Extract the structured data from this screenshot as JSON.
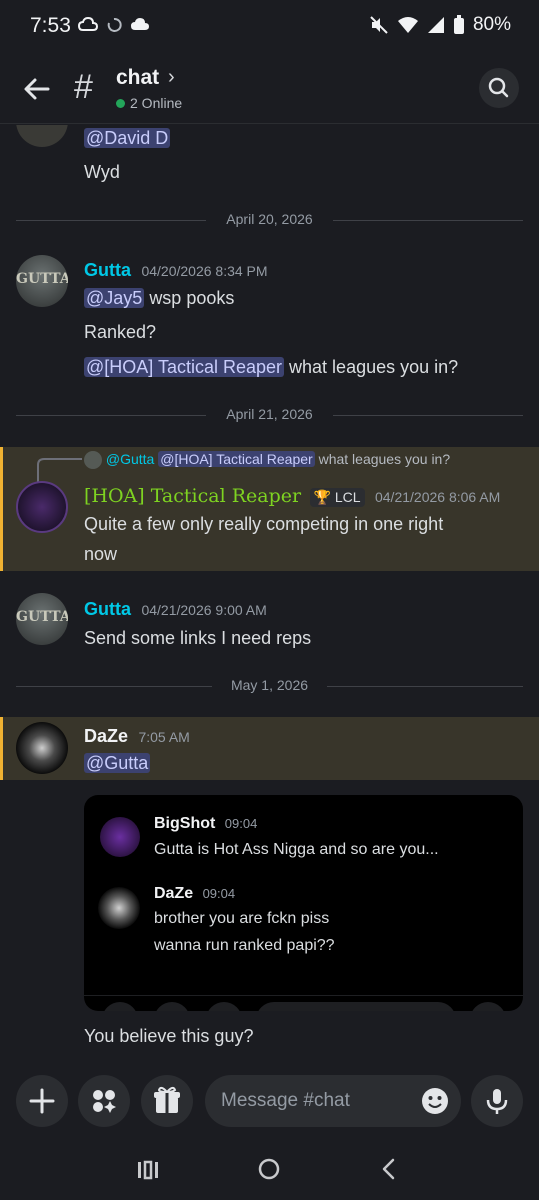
{
  "status": {
    "time": "7:53",
    "battery": "80%"
  },
  "header": {
    "channel": "chat",
    "online": "2 Online"
  },
  "messages": {
    "m0_mention": "@David D",
    "m0_text": "Wyd",
    "divider1": "April 20, 2026",
    "m1": {
      "name": "Gutta",
      "ts": "04/20/2026 8:34 PM",
      "avatar_text": "GUTTA",
      "l1_mention": "@Jay5",
      "l1_text": "wsp pooks",
      "l2": "Ranked?",
      "l3_mention": "@[HOA] Tactical Reaper",
      "l3_text": "what leagues you in?"
    },
    "divider2": "April 21, 2026",
    "m2": {
      "reply_name": "@Gutta",
      "reply_mention": "@[HOA] Tactical Reaper",
      "reply_text": "what leagues you in?",
      "name": "[HOA] Tactical Reaper",
      "badge": "LCL",
      "ts": "04/21/2026 8:06 AM",
      "text1": "Quite a few only really competing in one right",
      "text2": "now"
    },
    "m3": {
      "name": "Gutta",
      "ts": "04/21/2026 9:00 AM",
      "avatar_text": "GUTTA",
      "text": "Send some links I need reps"
    },
    "divider3": "May 1, 2026",
    "m4": {
      "name": "DaZe",
      "ts": "7:05 AM",
      "mention": "@Gutta"
    },
    "embed": {
      "e1": {
        "name": "BigShot",
        "ts": "09:04",
        "text": "Gutta is Hot Ass Nigga and so are you..."
      },
      "e2": {
        "name": "DaZe",
        "ts": "09:04",
        "text1": "brother you are fckn piss",
        "text2": "wanna run ranked papi??"
      }
    },
    "m4_text": "You believe this guy?"
  },
  "composer": {
    "placeholder": "Message #chat"
  },
  "colors": {
    "gutta": "#00c8e6",
    "reaper": "#7ed321",
    "highlight": "#38352a",
    "accent": "#f0b232",
    "mention_bg": "#3c4270"
  },
  "icons": [
    "back-arrow-icon",
    "hash-icon",
    "chevron-right-icon",
    "search-icon",
    "plus-icon",
    "apps-icon",
    "gift-icon",
    "emoji-icon",
    "mic-icon",
    "recents-icon",
    "home-icon",
    "back-icon"
  ]
}
